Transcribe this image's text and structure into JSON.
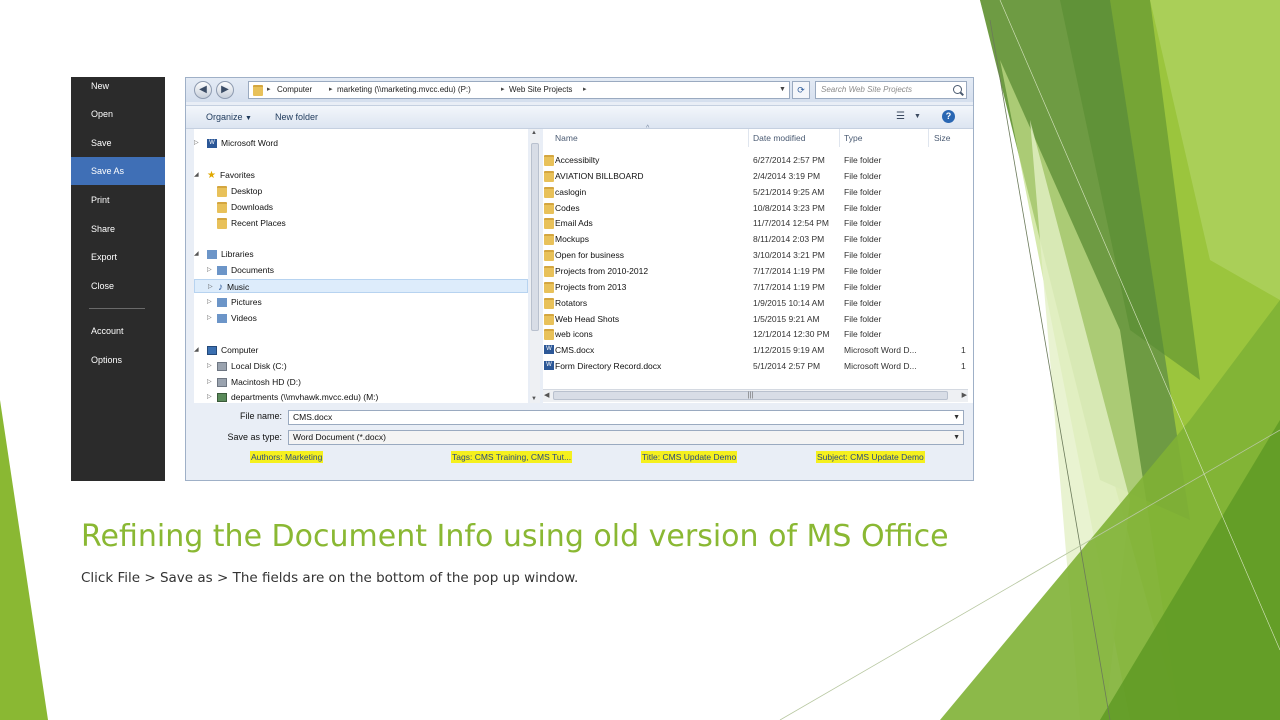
{
  "backstage": {
    "items": [
      {
        "label": "New",
        "active": false
      },
      {
        "label": "Open",
        "active": false
      },
      {
        "label": "Save",
        "active": false
      },
      {
        "label": "Save As",
        "active": true
      },
      {
        "label": "Print",
        "active": false
      },
      {
        "label": "Share",
        "active": false
      },
      {
        "label": "Export",
        "active": false
      },
      {
        "label": "Close",
        "active": false
      },
      {
        "label": "Account",
        "active": false
      },
      {
        "label": "Options",
        "active": false
      }
    ]
  },
  "dialog": {
    "address": {
      "crumbs": [
        "Computer",
        "marketing (\\\\marketing.mvcc.edu) (P:)",
        "Web Site Projects"
      ]
    },
    "search_placeholder": "Search Web Site Projects",
    "toolbar": {
      "organize": "Organize",
      "new_folder": "New folder"
    },
    "nav_tree": [
      {
        "label": "Microsoft Word",
        "icon": "word-icon",
        "expand": "closed",
        "selected": false
      },
      {
        "label": "Favorites",
        "icon": "star-icon",
        "expand": "open",
        "selected": false
      },
      {
        "label": "Desktop",
        "icon": "folder-icon",
        "expand": "none",
        "selected": false
      },
      {
        "label": "Downloads",
        "icon": "folder-icon",
        "expand": "none",
        "selected": false
      },
      {
        "label": "Recent Places",
        "icon": "folder-icon",
        "expand": "none",
        "selected": false
      },
      {
        "label": "Libraries",
        "icon": "library-icon",
        "expand": "open",
        "selected": false
      },
      {
        "label": "Documents",
        "icon": "library-icon",
        "expand": "closed",
        "selected": false
      },
      {
        "label": "Music",
        "icon": "music-icon",
        "expand": "closed",
        "selected": true
      },
      {
        "label": "Pictures",
        "icon": "library-icon",
        "expand": "closed",
        "selected": false
      },
      {
        "label": "Videos",
        "icon": "library-icon",
        "expand": "closed",
        "selected": false
      },
      {
        "label": "Computer",
        "icon": "computer-icon",
        "expand": "open",
        "selected": false
      },
      {
        "label": "Local Disk (C:)",
        "icon": "drive-icon",
        "expand": "closed",
        "selected": false
      },
      {
        "label": "Macintosh HD (D:)",
        "icon": "drive-icon",
        "expand": "closed",
        "selected": false
      },
      {
        "label": "departments (\\\\mvhawk.mvcc.edu) (M:)",
        "icon": "network-drive-icon",
        "expand": "closed",
        "selected": false
      }
    ],
    "columns": {
      "name": "Name",
      "date": "Date modified",
      "type": "Type",
      "size": "Size"
    },
    "files": [
      {
        "name": "Accessibilty",
        "date": "6/27/2014 2:57 PM",
        "type": "File folder",
        "size": "",
        "kind": "folder"
      },
      {
        "name": "AVIATION BILLBOARD",
        "date": "2/4/2014 3:19 PM",
        "type": "File folder",
        "size": "",
        "kind": "folder"
      },
      {
        "name": "caslogin",
        "date": "5/21/2014 9:25 AM",
        "type": "File folder",
        "size": "",
        "kind": "folder"
      },
      {
        "name": "Codes",
        "date": "10/8/2014 3:23 PM",
        "type": "File folder",
        "size": "",
        "kind": "folder"
      },
      {
        "name": "Email Ads",
        "date": "11/7/2014 12:54 PM",
        "type": "File folder",
        "size": "",
        "kind": "folder"
      },
      {
        "name": "Mockups",
        "date": "8/11/2014 2:03 PM",
        "type": "File folder",
        "size": "",
        "kind": "folder"
      },
      {
        "name": "Open for business",
        "date": "3/10/2014 3:21 PM",
        "type": "File folder",
        "size": "",
        "kind": "folder"
      },
      {
        "name": "Projects from 2010-2012",
        "date": "7/17/2014 1:19 PM",
        "type": "File folder",
        "size": "",
        "kind": "folder"
      },
      {
        "name": "Projects from 2013",
        "date": "7/17/2014 1:19 PM",
        "type": "File folder",
        "size": "",
        "kind": "folder"
      },
      {
        "name": "Rotators",
        "date": "1/9/2015 10:14 AM",
        "type": "File folder",
        "size": "",
        "kind": "folder"
      },
      {
        "name": "Web Head Shots",
        "date": "1/5/2015 9:21 AM",
        "type": "File folder",
        "size": "",
        "kind": "folder"
      },
      {
        "name": "web icons",
        "date": "12/1/2014 12:30 PM",
        "type": "File folder",
        "size": "",
        "kind": "folder"
      },
      {
        "name": "CMS.docx",
        "date": "1/12/2015 9:19 AM",
        "type": "Microsoft Word D...",
        "size": "1",
        "kind": "word"
      },
      {
        "name": "Form Directory Record.docx",
        "date": "5/1/2014 2:57 PM",
        "type": "Microsoft Word D...",
        "size": "1",
        "kind": "word"
      }
    ],
    "file_name_label": "File name:",
    "file_name_value": "CMS.docx",
    "save_type_label": "Save as type:",
    "save_type_value": "Word Document (*.docx)",
    "meta": {
      "authors_label": "Authors:",
      "authors_value": "Marketing",
      "tags_label": "Tags:",
      "tags_value": "CMS Training, CMS Tut...",
      "title_label": "Title:",
      "title_value": "CMS Update Demo",
      "subject_label": "Subject:",
      "subject_value": "CMS Update Demo"
    }
  },
  "slide": {
    "title": "Refining the Document Info using old version of MS Office",
    "subtitle": "Click File >  Save as > The fields are on the bottom of the pop up window."
  },
  "colors": {
    "title_green": "#8ab833",
    "backstage_bg": "#2b2b2b",
    "backstage_active": "#3f6fb6",
    "highlight_yellow": "#f5f01e"
  }
}
